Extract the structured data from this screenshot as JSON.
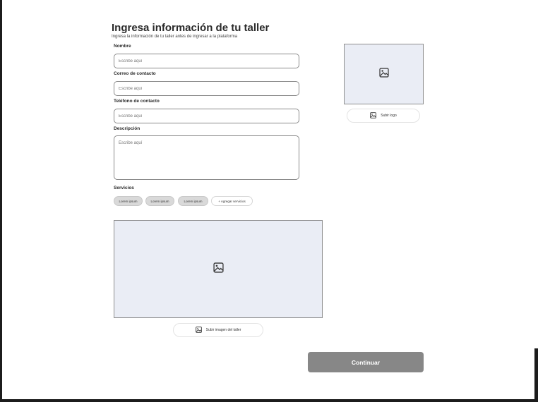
{
  "header": {
    "title": "Ingresa información de tu taller",
    "subtitle": "Ingresa la información de tu taller antes de ingresar a la plataforma"
  },
  "form": {
    "name": {
      "label": "Nombre",
      "placeholder": "Escribe aquí"
    },
    "email": {
      "label": "Correo de contacto",
      "placeholder": "Escribe aquí"
    },
    "phone": {
      "label": "Teléfono de contacto",
      "placeholder": "Escribe aquí"
    },
    "description": {
      "label": "Descripción",
      "placeholder": "Escribe aquí"
    }
  },
  "services": {
    "label": "Servicios",
    "chips": [
      "Lorem ipsum",
      "Lorem ipsum",
      "Lorem ipsum"
    ],
    "add_label": "+ Agregar servicios"
  },
  "logo": {
    "upload_label": "Subir logo",
    "icon": "image-icon"
  },
  "workshop_image": {
    "upload_label": "Subir imagen del taller",
    "icon": "image-icon"
  },
  "actions": {
    "continue_label": "Continuar"
  },
  "colors": {
    "image_placeholder": "#eaedf5",
    "continue_button": "#878787"
  }
}
